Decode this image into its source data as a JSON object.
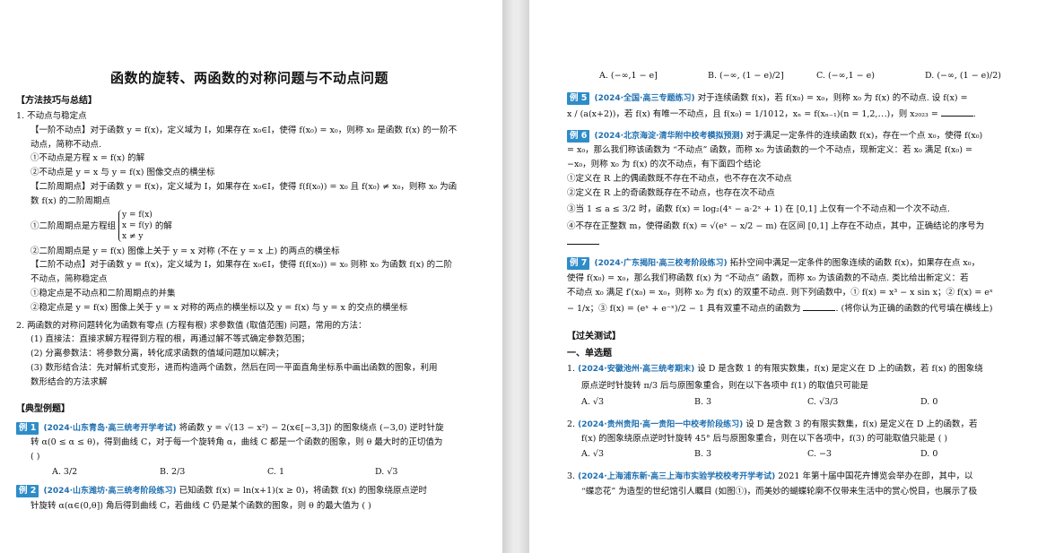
{
  "left": {
    "title": "函数的旋转、两函数的对称问题与不动点问题",
    "method_header": "【方法技巧与总结】",
    "lines": [
      "1.  不动点与稳定点",
      "【一阶不动点】对于函数 y = f(x)，定义域为 I，如果存在 x₀∈I，使得 f(x₀) = x₀，则称 x₀ 是函数 f(x) 的一阶不",
      "动点，简称不动点.",
      "①不动点是方程 x = f(x) 的解",
      "②不动点是 y = x 与 y = f(x) 图像交点的横坐标",
      "【二阶周期点】对于函数 y = f(x)，定义域为 I，如果存在 x₀∈I，使得 f(f(x₀)) = x₀ 且 f(x₀) ≠ x₀，则称 x₀ 为函",
      "数 f(x) 的二阶周期点"
    ],
    "system_prefix": "①二阶周期点是方程组",
    "system_lines": [
      "y = f(x)",
      "x = f(y)",
      "x ≠ y"
    ],
    "system_suffix": "的解",
    "lines2": [
      "②二阶周期点是 y = f(x) 图像上关于 y = x 对称 (不在 y = x 上) 的两点的横坐标",
      "【二阶不动点】对于函数 y = f(x)，定义域为 I，如果存在 x₀∈I，使得 f(f(x₀)) = x₀ 则称 x₀ 为函数 f(x) 的二阶",
      "不动点，简称稳定点",
      "①稳定点是不动点和二阶周期点的并集",
      "②稳定点是 y = f(x) 图像上关于 y = x 对称的两点的横坐标以及 y = f(x) 与 y = x 的交点的横坐标"
    ],
    "lines3": [
      "2.  两函数的对称问题转化为函数有零点 (方程有根) 求参数值 (取值范围) 问题，常用的方法：",
      "(1) 直接法：直接求解方程得到方程的根，再通过解不等式确定参数范围；",
      "(2) 分离参数法：将参数分离，转化成求函数的值域问题加以解决；",
      "(3) 数形结合法：先对解析式变形，进而构造两个函数，然后在同一平面直角坐标系中画出函数的图象，利用",
      "数形结合的方法求解"
    ],
    "typical_header": "【典型例题】",
    "ex1": {
      "badge": "例 1",
      "source": "(2024·山东青岛·高三统考开学考试)",
      "text1": "将函数 y = √(13 − x²) − 2(x∈[−3,3]) 的图象绕点 (−3,0) 逆时针旋",
      "text2": "转 α(0 ≤ α ≤ θ)，得到曲线 C，对于每一个旋转角 α，曲线 C 都是一个函数的图象，则 θ 最大时的正切值为",
      "text3": "(      )",
      "options": [
        "A. 3/2",
        "B. 2/3",
        "C. 1",
        "D. √3"
      ]
    },
    "ex2": {
      "badge": "例 2",
      "source": "(2024·山东潍坊·高三统考阶段练习)",
      "text1": "已知函数 f(x) = ln(x+1)(x ≥ 0)，将函数 f(x) 的图象绕原点逆时",
      "text2": "针旋转 α(α∈(0,θ]) 角后得到曲线 C，若曲线 C 仍是某个函数的图象，则 θ 的最大值为 (      )"
    }
  },
  "right": {
    "ex4_options": [
      "A. (−∞,1 − e]",
      "B. (−∞, (1 − e)/2]",
      "C. (−∞,1 − e)",
      "D. (−∞, (1 − e)/2)"
    ],
    "ex5": {
      "badge": "例 5",
      "source": "(2024·全国·高三专题练习)",
      "text1": "对于连续函数 f(x)，若 f(x₀) = x₀，则称 x₀ 为 f(x) 的不动点. 设 f(x) =",
      "text2": "x / (a(x+2))，若 f(x) 有唯一不动点，且 f(x₀) = 1/1012，xₙ = f(xₙ₋₁)(n = 1,2,⋯)，则 x₂₀₂₃ =",
      "tail": "."
    },
    "ex6": {
      "badge": "例 6",
      "source": "(2024·北京海淀·清华附中校考模拟预测)",
      "text1": "对于满足一定条件的连续函数 f(x)，存在一个点 x₀，使得 f(x₀)",
      "text2": "= x₀，那么我们称该函数为 “不动点” 函数，而称 x₀ 为该函数的一个不动点，现新定义：若 x₀ 满足 f(x₀) =",
      "text3": "−x₀，则称 x₀ 为 f(x) 的次不动点，有下面四个结论",
      "items": [
        "①定义在 R 上的偶函数既不存在不动点，也不存在次不动点",
        "②定义在 R 上的奇函数既存在不动点，也存在次不动点",
        "③当 1 ≤ a ≤ 3/2 时，函数 f(x) = log₂(4ˣ − a·2ˣ + 1) 在 [0,1] 上仅有一个不动点和一个次不动点.",
        "④不存在正整数 m，使得函数 f(x) = √(eˣ − x/2 − m) 在区间 [0,1] 上存在不动点，其中，正确结论的序号为"
      ]
    },
    "ex7": {
      "badge": "例 7",
      "source": "(2024·广东揭阳·高三校考阶段练习)",
      "text1": "拓扑空间中满足一定条件的图象连续的函数 f(x)，如果存在点 x₀，",
      "text2": "使得 f(x₀) = x₀，那么我们称函数 f(x) 为 “不动点” 函数，而称 x₀ 为该函数的不动点. 类比给出新定义：若",
      "text3": "不动点 x₀ 满足 f′(x₀) = x₀，则称 x₀ 为 f(x) 的双重不动点. 则下列函数中，① f(x) = x³ − x sin x；② f(x) = eˣ",
      "text4": "− 1/x；③ f(x) = (eˣ + e⁻ˣ)/2 − 1 具有双重不动点的函数为",
      "tail": ". (将你认为正确的函数的代号填在横线上)"
    },
    "test_header": "【过关测试】",
    "single_header": "一、单选题",
    "q1": {
      "num": "1.",
      "source": "(2024·安徽池州·高三统考期末)",
      "text1": "设 D 是含数 1 的有限实数集，f(x) 是定义在 D 上的函数，若 f(x) 的图象绕",
      "text2": "原点逆时针旋转 π/3 后与原图象重合，则在以下各项中 f(1) 的取值只可能是",
      "options": [
        "A. √3",
        "B. 3",
        "C. √3/3",
        "D. 0"
      ]
    },
    "q2": {
      "num": "2.",
      "source": "(2024·贵州贵阳·高一贵阳一中校考阶段练习)",
      "text1": "设 D 是含数 3 的有限实数集，f(x) 是定义在 D 上的函数，若",
      "text2": "f(x) 的图象绕原点逆时针旋转 45° 后与原图象重合，则在以下各项中，f(3) 的可能取值只能是 (      )",
      "options": [
        "A. √3",
        "B. 3",
        "C. −3",
        "D. 0"
      ]
    },
    "q3": {
      "num": "3.",
      "source": "(2024·上海浦东新·高三上海市实验学校校考开学考试)",
      "text1": "2021 年第十届中国花卉博览会举办在即，其中，以",
      "text2": "“蝶恋花” 为造型的世纪馆引人瞩目 (如图①)，而美妙的蝴蝶轮廓不仅带来生活中的赏心悦目，也展示了极"
    }
  }
}
